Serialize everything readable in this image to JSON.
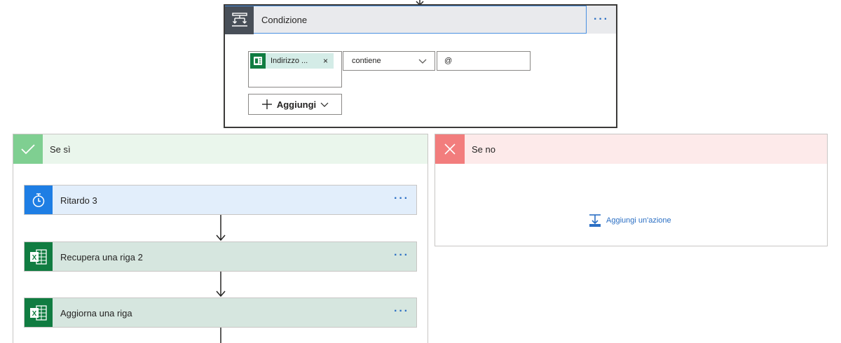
{
  "condition": {
    "title": "Condizione",
    "menu_label": "···",
    "token_label": "Indirizzo ...",
    "token_remove": "×",
    "operator": "contiene",
    "value": "@",
    "add_button_label": "Aggiungi"
  },
  "branch_yes": {
    "title": "Se sì",
    "actions": [
      {
        "title": "Ritardo 3",
        "menu": "···"
      },
      {
        "title": "Recupera una riga 2",
        "menu": "···"
      },
      {
        "title": "Aggiorna una riga",
        "menu": "···"
      }
    ]
  },
  "branch_no": {
    "title": "Se no",
    "add_action_label": "Aggiungi un'azione"
  },
  "icons": {
    "condition": "condition-icon",
    "check": "check-icon",
    "close": "close-icon",
    "timer": "timer-icon",
    "excel": "excel-icon",
    "forms": "forms-icon",
    "chevron": "chevron-down-icon",
    "plus": "plus-icon",
    "add_action": "add-action-icon"
  },
  "colors": {
    "accent_blue": "#2b6fc4",
    "excel_green": "#107c41",
    "timer_blue": "#1e7ee4",
    "yes_green": "#7fcf91",
    "no_red": "#f27d7d"
  }
}
